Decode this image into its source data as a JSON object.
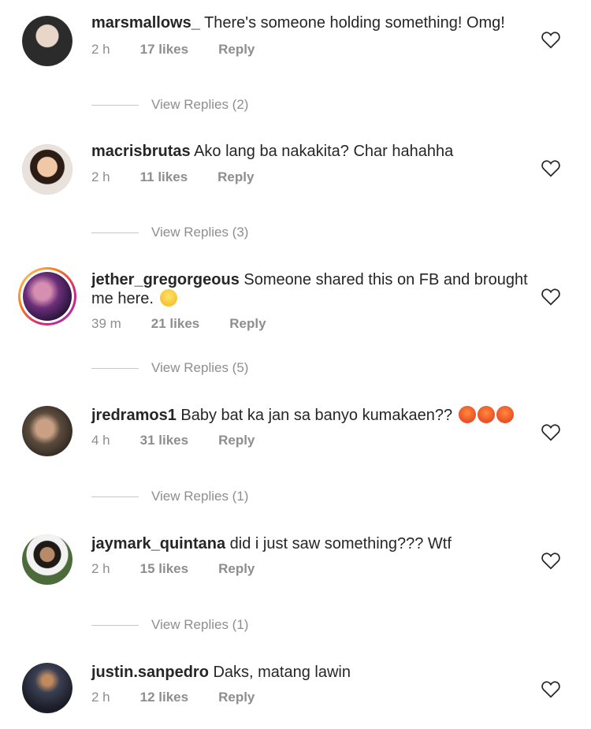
{
  "comments": [
    {
      "username": "marsmallows_",
      "text": "There's someone holding something! Omg!",
      "time": "2 h",
      "likes": "17 likes",
      "reply": "Reply",
      "view_replies": "View Replies (2)",
      "avatar_color": "#2b2b2b",
      "story_ring": false
    },
    {
      "username": "macrisbrutas",
      "text": "Ako lang ba nakakita? Char hahahha",
      "time": "2 h",
      "likes": "11 likes",
      "reply": "Reply",
      "view_replies": "View Replies (3)",
      "avatar_color": "#c98b5b",
      "story_ring": false
    },
    {
      "username": "jether_gregorgeous",
      "text": "Someone shared this on FB and brought me here.",
      "emoji": "laughing-tears",
      "time": "39 m",
      "likes": "21 likes",
      "reply": "Reply",
      "view_replies": "View Replies (5)",
      "avatar_color": "#5a2a6e",
      "story_ring": true
    },
    {
      "username": "jredramos1",
      "text": "Baby bat ka jan sa banyo kumakaen??",
      "emoji": "angry-face x3",
      "time": "4 h",
      "likes": "31 likes",
      "reply": "Reply",
      "view_replies": "View Replies (1)",
      "avatar_color": "#5b4b3d",
      "story_ring": false
    },
    {
      "username": "jaymark_quintana",
      "text": "did i just saw something??? Wtf",
      "time": "2 h",
      "likes": "15 likes",
      "reply": "Reply",
      "view_replies": "View Replies (1)",
      "avatar_color": "#4c6a3a",
      "story_ring": false
    },
    {
      "username": "justin.sanpedro",
      "text": "Daks, matang lawin",
      "time": "2 h",
      "likes": "12 likes",
      "reply": "Reply",
      "avatar_color": "#3a3f52",
      "story_ring": false
    }
  ]
}
